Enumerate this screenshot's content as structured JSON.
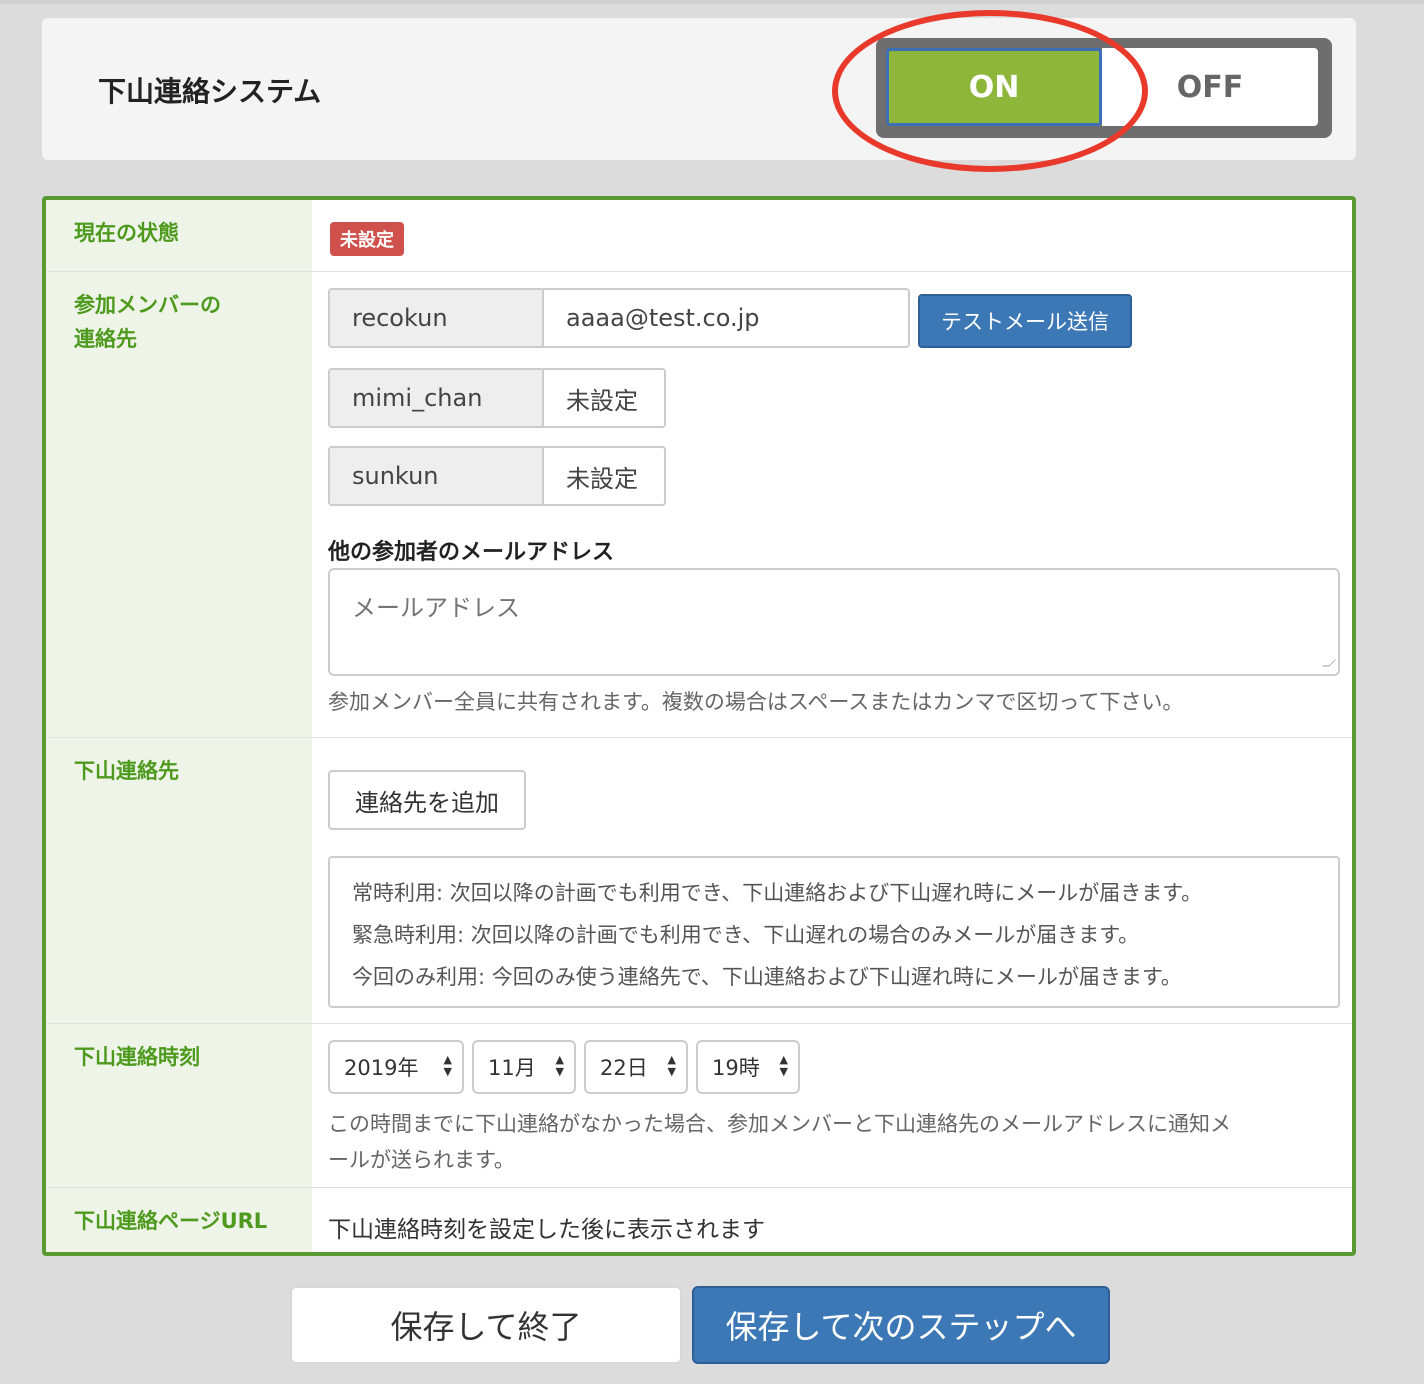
{
  "header": {
    "title": "下山連絡システム",
    "toggle_on": "ON",
    "toggle_off": "OFF",
    "selected": "ON"
  },
  "status_row": {
    "label": "現在の状態",
    "badge": "未設定"
  },
  "members_row": {
    "label_line1": "参加メンバーの",
    "label_line2": "連絡先",
    "members": [
      {
        "name": "recokun",
        "email": "aaaa@test.co.jp"
      },
      {
        "name": "mimi_chan",
        "email": "未設定"
      },
      {
        "name": "sunkun",
        "email": "未設定"
      }
    ],
    "test_mail_button": "テストメール送信",
    "other_heading": "他の参加者のメールアドレス",
    "other_placeholder": "メールアドレス",
    "other_help": "参加メンバー全員に共有されます。複数の場合はスペースまたはカンマで区切って下さい。"
  },
  "contacts_row": {
    "label": "下山連絡先",
    "add_button": "連絡先を追加",
    "info_lines": [
      "常時利用: 次回以降の計画でも利用でき、下山連絡および下山遅れ時にメールが届きます。",
      "緊急時利用: 次回以降の計画でも利用でき、下山遅れの場合のみメールが届きます。",
      "今回のみ利用: 今回のみ使う連絡先で、下山連絡および下山遅れ時にメールが届きます。"
    ]
  },
  "time_row": {
    "label": "下山連絡時刻",
    "year": "2019年",
    "month": "11月",
    "day": "22日",
    "hour": "19時",
    "help_line1": "この時間までに下山連絡がなかった場合、参加メンバーと下山連絡先のメールアドレスに通知メ",
    "help_line2": "ールが送られます。"
  },
  "url_row": {
    "label": "下山連絡ページURL",
    "text": "下山連絡時刻を設定した後に表示されます"
  },
  "footer": {
    "save_exit": "保存して終了",
    "save_next": "保存して次のステップへ"
  },
  "colors": {
    "toggle_on": "#8db63a",
    "primary": "#3d78b6",
    "label_green": "#4e9a1e",
    "badge_red": "#d0504b",
    "highlight": "#e8392b"
  }
}
